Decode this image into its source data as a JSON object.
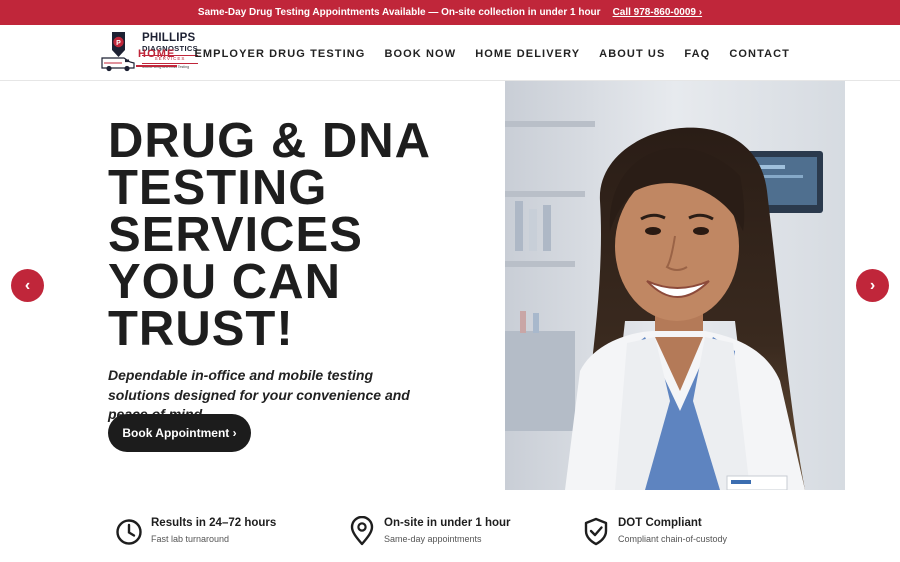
{
  "topbar": {
    "message": "Same-Day Drug Testing Appointments Available — On-site collection in under 1 hour",
    "call": "Call 978-860-0009 ›"
  },
  "logo": {
    "line1": "PHILLIPS",
    "line2": "DIAGNOSTICS",
    "line3": "SERVICES",
    "line4": "Mobile Drug and DNA Testing"
  },
  "nav": [
    {
      "label": "HOME",
      "active": true
    },
    {
      "label": "EMPLOYER DRUG TESTING"
    },
    {
      "label": "BOOK NOW"
    },
    {
      "label": "HOME DELIVERY"
    },
    {
      "label": "ABOUT US"
    },
    {
      "label": "FAQ"
    },
    {
      "label": "CONTACT"
    }
  ],
  "hero": {
    "title_lines": [
      "DRUG & DNA",
      "TESTING",
      "SERVICES",
      "YOU CAN",
      "TRUST!"
    ],
    "subtitle": "Dependable in-office and mobile testing solutions designed for your convenience and peace of mind.",
    "cta": "Book Appointment ›",
    "prev": "‹",
    "next": "›"
  },
  "features": [
    {
      "icon": "clock-icon",
      "title": "Results in 24–72 hours",
      "subtitle": "Fast lab turnaround"
    },
    {
      "icon": "map-pin-icon",
      "title": "On-site in under 1 hour",
      "subtitle": "Same-day appointments"
    },
    {
      "icon": "shield-check-icon",
      "title": "DOT Compliant",
      "subtitle": "Compliant chain-of-custody"
    }
  ],
  "colors": {
    "accent": "#c0263a",
    "dark": "#1c1c1c"
  }
}
